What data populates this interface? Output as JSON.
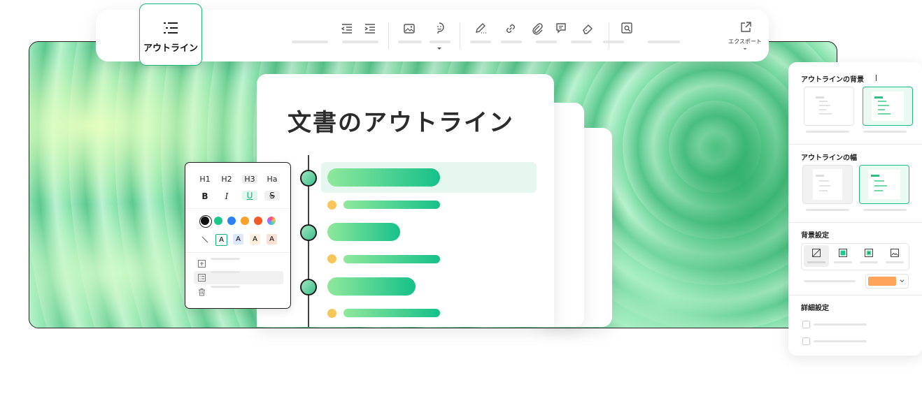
{
  "toolbar": {
    "outline_label": "アウトライン",
    "export_label": "エクスポート",
    "icons": [
      "outdent-icon",
      "indent-icon",
      "image-icon",
      "sticker-icon",
      "pen-icon",
      "link-icon",
      "attachment-icon",
      "comment-icon",
      "eraser-icon",
      "search-doc-icon",
      "export-icon"
    ]
  },
  "document": {
    "title": "文書のアウトライン"
  },
  "format_panel": {
    "headings": [
      "H1",
      "H2",
      "H3",
      "Ha"
    ],
    "styles": [
      "B",
      "I",
      "U",
      "S"
    ],
    "colors": [
      "#111111",
      "#1cc98a",
      "#2f7ff5",
      "#f7a12a",
      "#f25a2b",
      "rainbow"
    ],
    "highlight_letters": [
      "A",
      "A",
      "A",
      "A"
    ]
  },
  "right_panel": {
    "outline_background_title": "アウトラインの背景",
    "outline_width_title": "アウトラインの幅",
    "background_settings_title": "背景設定",
    "detail_settings_title": "詳細設定",
    "accent_color": "#ffa45a"
  },
  "colors": {
    "accent": "#16c08a",
    "bullet": "#f7c65a"
  }
}
